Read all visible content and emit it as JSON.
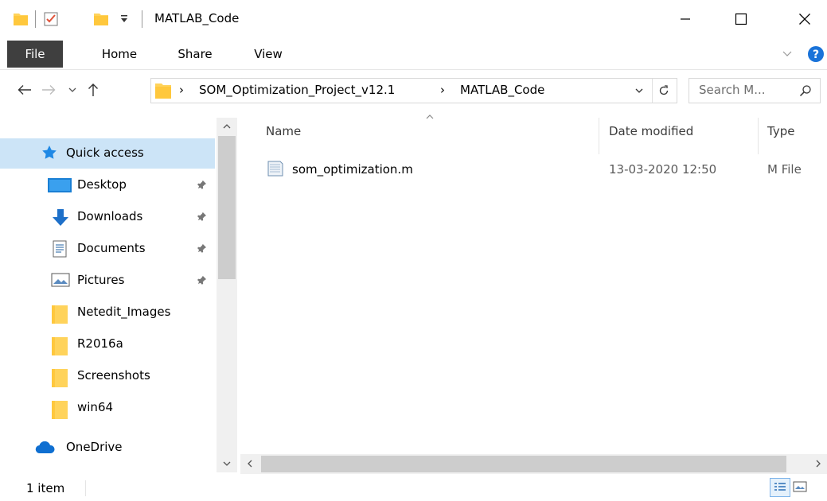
{
  "window": {
    "title": "MATLAB_Code"
  },
  "ribbon": {
    "tabs": [
      "File",
      "Home",
      "Share",
      "View"
    ]
  },
  "address": {
    "crumbs": [
      "SOM_Optimization_Project_v12.1",
      "MATLAB_Code"
    ],
    "search_placeholder": "Search M..."
  },
  "nav": {
    "quick_access": "Quick access",
    "items": [
      {
        "label": "Desktop",
        "icon": "desktop-icon",
        "pinned": true
      },
      {
        "label": "Downloads",
        "icon": "downloads-icon",
        "pinned": true
      },
      {
        "label": "Documents",
        "icon": "documents-icon",
        "pinned": true
      },
      {
        "label": "Pictures",
        "icon": "pictures-icon",
        "pinned": true
      },
      {
        "label": "Netedit_Images",
        "icon": "folder-icon",
        "pinned": false
      },
      {
        "label": "R2016a",
        "icon": "folder-icon",
        "pinned": false
      },
      {
        "label": "Screenshots",
        "icon": "folder-icon",
        "pinned": false
      },
      {
        "label": "win64",
        "icon": "folder-icon",
        "pinned": false
      }
    ],
    "onedrive": "OneDrive"
  },
  "columns": {
    "name": "Name",
    "date": "Date modified",
    "type": "Type"
  },
  "files": [
    {
      "name": "som_optimization.m",
      "date": "13-03-2020 12:50",
      "type": "M File"
    }
  ],
  "status": {
    "count": "1 item"
  },
  "colors": {
    "accent": "#0078d7",
    "selected": "#cce4f7",
    "folder": "#ffd35b",
    "file_tab": "#3f3f3f"
  }
}
